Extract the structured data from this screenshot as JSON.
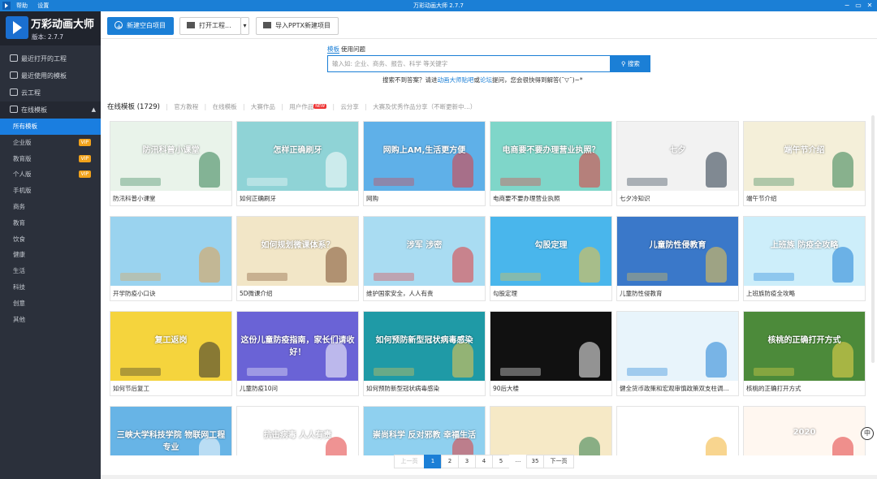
{
  "window": {
    "menu": [
      "帮助",
      "设置"
    ],
    "title": "万彩动画大师 2.7.7",
    "controls": [
      "−",
      "▭",
      "✕"
    ]
  },
  "brand": {
    "name": "万彩动画大师",
    "version": "版本: 2.7.7"
  },
  "nav": {
    "items": [
      "最近打开的工程",
      "最近使用的模板",
      "云工程"
    ],
    "section": "在线模板",
    "sub": [
      {
        "label": "所有模板",
        "vip": ""
      },
      {
        "label": "企业版",
        "vip": "VIP"
      },
      {
        "label": "教育版",
        "vip": "VIP"
      },
      {
        "label": "个人版",
        "vip": "VIP"
      },
      {
        "label": "手机版",
        "vip": ""
      },
      {
        "label": "商务",
        "vip": ""
      },
      {
        "label": "教育",
        "vip": ""
      },
      {
        "label": "饮食",
        "vip": ""
      },
      {
        "label": "健康",
        "vip": ""
      },
      {
        "label": "生活",
        "vip": ""
      },
      {
        "label": "科技",
        "vip": ""
      },
      {
        "label": "创意",
        "vip": ""
      },
      {
        "label": "其他",
        "vip": ""
      }
    ]
  },
  "toolbar": {
    "new_label": "新建空白项目",
    "open_label": "打开工程...",
    "dropdown_glyph": "▾",
    "import_label": "导入PPTX新建项目"
  },
  "search": {
    "tab_template": "模板",
    "tab_question": "使用问题",
    "placeholder": "输入如: 企业、商务、报告、科学 等关键字",
    "button": "搜索",
    "hint_before": "搜索不到答案？请进",
    "hint_link1": "动画大师贴吧",
    "hint_mid": "或",
    "hint_link2": "论坛",
    "hint_after": "提问，您会很快得到解答(¯▽¯)~*"
  },
  "filters": {
    "current": "在线模板 (1729)",
    "items": [
      "官方教程",
      "在线模板",
      "大赛作品",
      "用户作品",
      "云分享",
      "大赛及优秀作品分享（不断更新中...）"
    ],
    "new_badge": "NEW"
  },
  "cards": [
    {
      "label": "防汛科普小课堂",
      "thumb": "防汛科普小课堂",
      "bg": "#e9f3ea",
      "accent": "#2f7d4f"
    },
    {
      "label": "如何正确刷牙",
      "thumb": "怎样正确刷牙",
      "bg": "#8fd3d6",
      "accent": "#ffffff"
    },
    {
      "label": "网购",
      "thumb": "网购上AM,生活更方便",
      "bg": "#5fb0e8",
      "accent": "#e23b3b"
    },
    {
      "label": "电商要不要办理营业执照",
      "thumb": "电商要不要办理营业执照？",
      "bg": "#7fd6c9",
      "accent": "#e23b3b"
    },
    {
      "label": "七夕冷知识",
      "thumb": "七夕",
      "bg": "#f2f2f2",
      "accent": "#223344"
    },
    {
      "label": "端午节介绍",
      "thumb": "端午节介绍",
      "bg": "#f4efd9",
      "accent": "#2f7d4f"
    },
    {
      "label": "开学防疫小口诀",
      "thumb": "",
      "bg": "#9ad3ef",
      "accent": "#e3a04b"
    },
    {
      "label": "5D微课介绍",
      "thumb": "如何规划微课体系？",
      "bg": "#f2e6c7",
      "accent": "#7a4b2a"
    },
    {
      "label": "维护国家安全，人人有责",
      "thumb": "涉军  涉密",
      "bg": "#a9dcf2",
      "accent": "#e23b3b"
    },
    {
      "label": "勾股定理",
      "thumb": "勾股定理",
      "bg": "#49b6ec",
      "accent": "#f4c23b"
    },
    {
      "label": "儿童防性侵教育",
      "thumb": "儿童防性侵教育",
      "bg": "#3a78c9",
      "accent": "#f0c64a"
    },
    {
      "label": "上班族防疫全攻略",
      "thumb": "上班族 防疫全攻略",
      "bg": "#cdeefa",
      "accent": "#1b7fd6"
    },
    {
      "label": "如何节后复工",
      "thumb": "复工返岗",
      "bg": "#f5d43d",
      "accent": "#2d2d2d"
    },
    {
      "label": "儿童防疫10问",
      "thumb": "这份儿童防疫指南，家长们请收好！",
      "bg": "#6a63d6",
      "accent": "#ffffff"
    },
    {
      "label": "如何预防新型冠状病毒感染",
      "thumb": "如何预防新型冠状病毒感染",
      "bg": "#1f9aa6",
      "accent": "#f2c94c"
    },
    {
      "label": "90后大楼",
      "thumb": "",
      "bg": "#111111",
      "accent": "#ffffff"
    },
    {
      "label": "健全货币政策和宏观审慎政策双支柱调...",
      "thumb": "",
      "bg": "#e8f4fb",
      "accent": "#1b7fd6"
    },
    {
      "label": "核桃的正确打开方式",
      "thumb": "核桃的正确打开方式",
      "bg": "#4c8a3a",
      "accent": "#f2d94c"
    },
    {
      "label": "",
      "thumb": "三峡大学科技学院 物联网工程专业",
      "bg": "#67b4e6",
      "accent": "#ffffff"
    },
    {
      "label": "",
      "thumb": "抗击病毒 人人有责",
      "bg": "#ffffff",
      "accent": "#e23b3b"
    },
    {
      "label": "",
      "thumb": "崇尚科学 反对邪教 幸福生活",
      "bg": "#8fd0ef",
      "accent": "#e23b3b"
    },
    {
      "label": "",
      "thumb": "",
      "bg": "#f6e9c6",
      "accent": "#2f7d4f"
    },
    {
      "label": "",
      "thumb": "",
      "bg": "#ffffff",
      "accent": "#f2b233"
    },
    {
      "label": "",
      "thumb": "2020",
      "bg": "#fff7f0",
      "accent": "#e23b3b"
    }
  ],
  "pager": {
    "prev": "上一页",
    "pages": [
      "1",
      "2",
      "3",
      "4",
      "5"
    ],
    "dots": "...",
    "last": "35",
    "next": "下一页",
    "current": "1"
  },
  "float_widget": "中"
}
